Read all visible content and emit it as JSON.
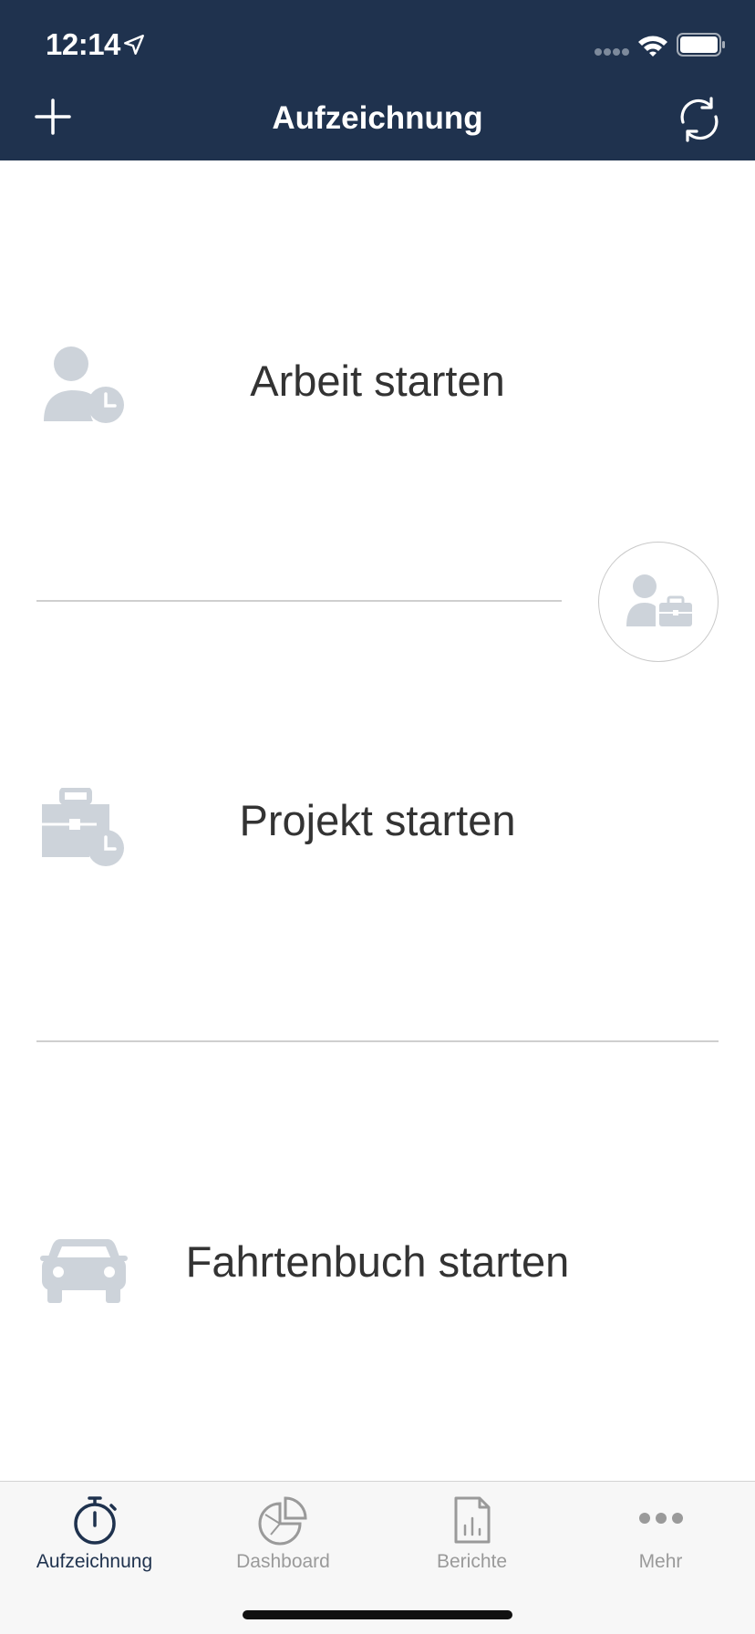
{
  "status_bar": {
    "time": "12:14"
  },
  "header": {
    "title": "Aufzeichnung"
  },
  "actions": [
    {
      "label": "Arbeit starten",
      "icon": "user-clock-icon"
    },
    {
      "label": "Projekt starten",
      "icon": "briefcase-clock-icon"
    },
    {
      "label": "Fahrtenbuch starten",
      "icon": "car-icon"
    }
  ],
  "tabs": [
    {
      "label": "Aufzeichnung",
      "icon": "stopwatch-icon",
      "active": true
    },
    {
      "label": "Dashboard",
      "icon": "pie-chart-icon",
      "active": false
    },
    {
      "label": "Berichte",
      "icon": "report-document-icon",
      "active": false
    },
    {
      "label": "Mehr",
      "icon": "more-dots-icon",
      "active": false
    }
  ],
  "colors": {
    "header_bg": "#1f324e",
    "icon_gray": "#cdd3da",
    "active_tab": "#1f324e",
    "inactive_tab": "#9a9a9a"
  }
}
